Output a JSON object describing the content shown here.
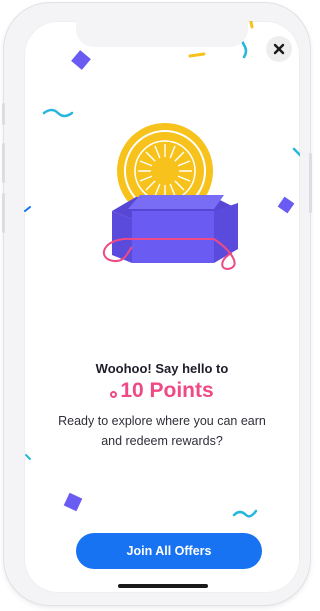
{
  "dialog": {
    "headline": "Woohoo! Say hello to",
    "points_label": "10 Points",
    "message": "Ready to explore where you can earn and redeem rewards?",
    "cta_label": "Join All Offers",
    "close_icon": "close-icon"
  },
  "colors": {
    "accent_pink": "#ee4a86",
    "primary_blue": "#1773f1",
    "coin_yellow": "#f6c21b",
    "box_purple": "#6a5cf2",
    "confetti_teal": "#28b6dc"
  },
  "illustration": {
    "icon": "gift-box-with-gold-coin"
  }
}
